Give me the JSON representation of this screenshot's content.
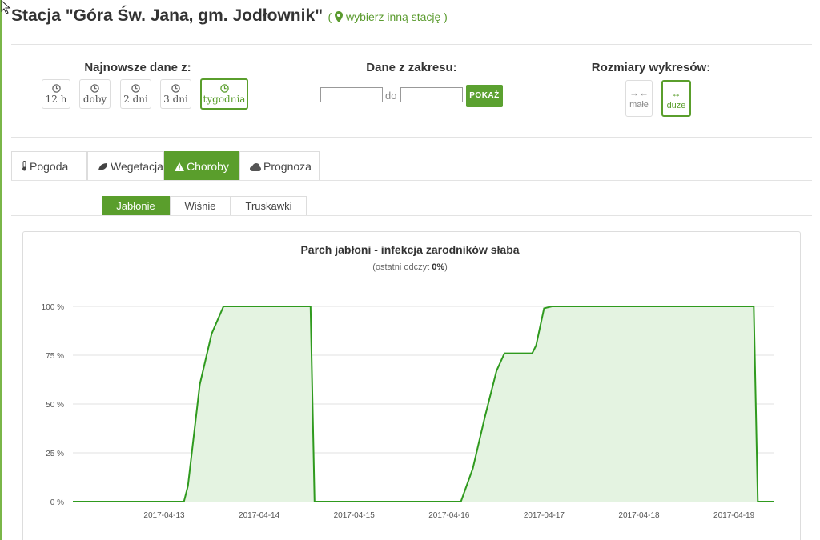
{
  "header": {
    "station_prefix": "Stacja ",
    "station_name": "\"Góra Św. Jana, gm. Jodłownik\"",
    "change_station_link": "wybierz inną stację",
    "paren_open": "(",
    "paren_close": ")"
  },
  "controls": {
    "latest_label": "Najnowsze dane z:",
    "range_label": "Dane z zakresu:",
    "size_label": "Rozmiary wykresów:",
    "time_buttons": [
      "12 h",
      "doby",
      "2 dni",
      "3 dni",
      "tygodnia"
    ],
    "active_time_button": "tygodnia",
    "date_from_value": "",
    "date_to_value": "",
    "between_label": "do",
    "show_button": "POKAŻ",
    "size_small": "małe",
    "size_large": "duże",
    "active_size": "duże"
  },
  "tabs": {
    "items": [
      "Pogoda",
      "Wegetacja",
      "Choroby",
      "Prognoza"
    ],
    "active": "Choroby"
  },
  "subtabs": {
    "items": [
      "Jabłonie",
      "Wiśnie",
      "Truskawki"
    ],
    "active": "Jabłonie"
  },
  "colors": {
    "accent": "#5a9e2c",
    "line": "#2f9a1e",
    "area": "#e4f3e1"
  },
  "chart_data": {
    "type": "area",
    "title": "Parch jabłoni - infekcja zarodników słaba",
    "subtitle_prefix": "(ostatni odczyt ",
    "subtitle_value": "0%",
    "subtitle_suffix": ")",
    "y_ticks": [
      "0 %",
      "25 %",
      "50 %",
      "75 %",
      "100 %"
    ],
    "ylim": [
      0,
      100
    ],
    "x_ticks": [
      "2017-04-13",
      "2017-04-14",
      "2017-04-15",
      "2017-04-16",
      "2017-04-17",
      "2017-04-18",
      "2017-04-19"
    ],
    "x_range": [
      "2017-04-12 00:00",
      "2017-04-19 06:00"
    ],
    "grid": true,
    "series": [
      {
        "points": [
          [
            "2017-04-12 00:00",
            0
          ],
          [
            "2017-04-13 05:00",
            0
          ],
          [
            "2017-04-13 06:00",
            8
          ],
          [
            "2017-04-13 09:00",
            60
          ],
          [
            "2017-04-13 12:00",
            86
          ],
          [
            "2017-04-13 15:00",
            100
          ],
          [
            "2017-04-14 13:00",
            100
          ],
          [
            "2017-04-14 14:00",
            0
          ],
          [
            "2017-04-16 03:00",
            0
          ],
          [
            "2017-04-16 06:00",
            17
          ],
          [
            "2017-04-16 09:00",
            43
          ],
          [
            "2017-04-16 12:00",
            67
          ],
          [
            "2017-04-16 14:00",
            76
          ],
          [
            "2017-04-16 21:00",
            76
          ],
          [
            "2017-04-16 22:00",
            80
          ],
          [
            "2017-04-17 00:00",
            99
          ],
          [
            "2017-04-17 02:00",
            100
          ],
          [
            "2017-04-19 05:00",
            100
          ],
          [
            "2017-04-19 06:00",
            0
          ],
          [
            "2017-04-19 13:00",
            0
          ]
        ]
      }
    ]
  }
}
